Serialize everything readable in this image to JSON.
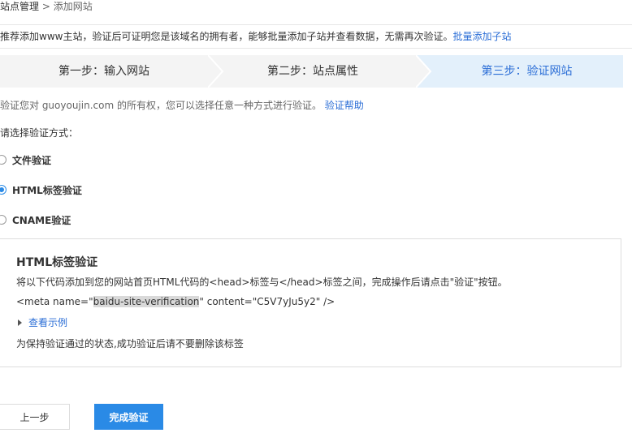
{
  "breadcrumb": {
    "parent": "站点管理",
    "separator": " > ",
    "current": "添加网站"
  },
  "tip": {
    "text": "推荐添加www主站，验证后可证明您是该域名的拥有者，能够批量添加子站并查看数据，无需再次验证。",
    "link": "批量添加子站"
  },
  "steps": [
    {
      "label": "第一步：输入网站",
      "active": false
    },
    {
      "label": "第二步：站点属性",
      "active": false
    },
    {
      "label": "第三步：验证网站",
      "active": true
    }
  ],
  "verify": {
    "text": "验证您对 guoyoujin.com 的所有权，您可以选择任意一种方式进行验证。",
    "help_link": "验证帮助"
  },
  "choose_label": "请选择验证方式：",
  "methods": [
    {
      "label": "文件验证",
      "checked": false
    },
    {
      "label": "HTML标签验证",
      "checked": true
    },
    {
      "label": "CNAME验证",
      "checked": false
    }
  ],
  "panel": {
    "title": "HTML标签验证",
    "description": "将以下代码添加到您的网站首页HTML代码的<head>标签与</head>标签之间，完成操作后请点击\"验证\"按钮。",
    "code_prefix": "<meta name=\"",
    "code_highlight": "baidu-site-verification",
    "code_suffix": "\" content=\"C5V7yJu5y2\" />",
    "example_link": "查看示例",
    "note": "为保持验证通过的状态,成功验证后请不要删除该标签"
  },
  "buttons": {
    "prev": "上一步",
    "finish": "完成验证"
  },
  "colors": {
    "accent": "#2a8ae6",
    "link": "#2a6dd6",
    "active_step_bg": "#e3f0fb",
    "steps_bg": "#f4f4f4"
  }
}
